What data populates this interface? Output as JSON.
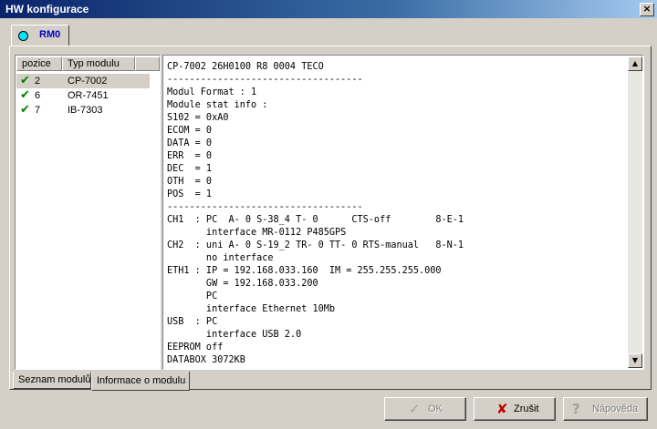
{
  "window": {
    "title": "HW konfigurace",
    "close_symbol": "×"
  },
  "top_tab": {
    "label": "RM0",
    "icon": "circle-indicator-icon",
    "icon_color": "#00e5ff"
  },
  "modules": {
    "headers": [
      "pozice",
      "Typ modulu"
    ],
    "rows": [
      {
        "position": "2",
        "type": "CP-7002",
        "status": "ok",
        "selected": true
      },
      {
        "position": "6",
        "type": "OR-7451",
        "status": "ok",
        "selected": false
      },
      {
        "position": "7",
        "type": "IB-7303",
        "status": "ok",
        "selected": false
      }
    ]
  },
  "info_text": "CP-7002 26H0100 R8 0004 TECO\n-----------------------------------\nModul Format : 1\nModule stat info :\nS102 = 0xA0\nECOM = 0\nDATA = 0\nERR  = 0\nDEC  = 1\nOTH  = 0\nPOS  = 1\n-----------------------------------\nCH1  : PC  A- 0 S-38_4 T- 0      CTS-off        8-E-1\n       interface MR-0112 P485GPS\nCH2  : uni A- 0 S-19_2 TR- 0 TT- 0 RTS-manual   8-N-1\n       no interface\nETH1 : IP = 192.168.033.160  IM = 255.255.255.000\n       GW = 192.168.033.200\n       PC\n       interface Ethernet 10Mb\nUSB  : PC\n       interface USB 2.0\nEEPROM off\nDATABOX 3072KB",
  "bottom_tabs": [
    {
      "label": "Seznam modulů",
      "active": false
    },
    {
      "label": "Informace o modulu",
      "active": true
    }
  ],
  "buttons": {
    "ok": {
      "label": "OK",
      "icon": "checkmark-icon",
      "enabled": false
    },
    "cancel": {
      "label": "Zrušit",
      "icon": "red-x-icon",
      "enabled": true,
      "icon_color": "#c00000"
    },
    "help": {
      "label": "Nápověda",
      "icon": "question-mark-icon",
      "enabled": false
    }
  },
  "colors": {
    "title_bar": "#0a246a",
    "face": "#d4d0c8",
    "check": "#008000"
  }
}
